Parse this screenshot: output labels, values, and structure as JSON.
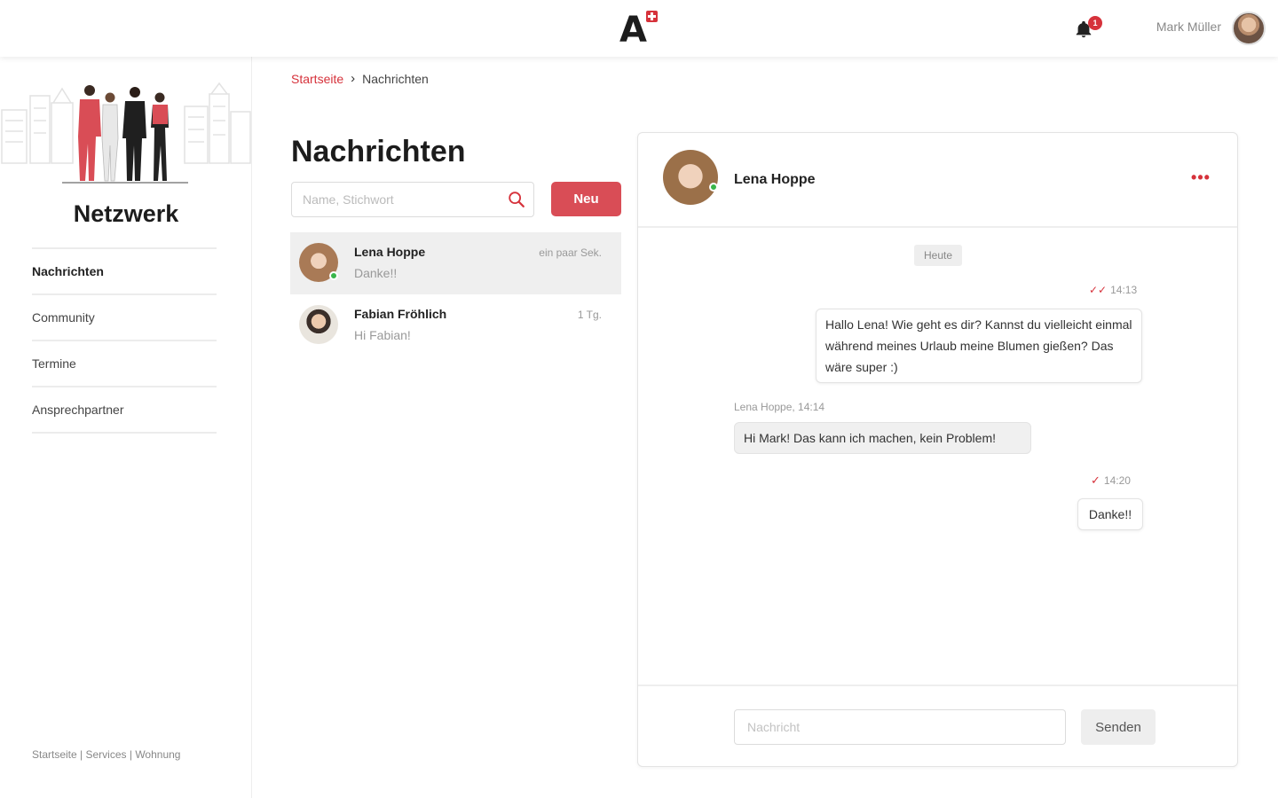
{
  "header": {
    "logo_letter": "A",
    "notification_count": "1",
    "user_name": "Mark Müller"
  },
  "sidebar": {
    "title": "Netzwerk",
    "items": [
      {
        "label": "Nachrichten",
        "active": true
      },
      {
        "label": "Community",
        "active": false
      },
      {
        "label": "Termine",
        "active": false
      },
      {
        "label": "Ansprechpartner",
        "active": false
      }
    ],
    "footer": {
      "link_1": "Startseite",
      "link_2": "Services",
      "link_3": "Wohnung",
      "separator": " | "
    }
  },
  "breadcrumb": {
    "home": "Startseite",
    "separator": "›",
    "current": "Nachrichten"
  },
  "page": {
    "title": "Nachrichten",
    "search_placeholder": "Name, Stichwort",
    "new_button": "Neu"
  },
  "conversations": [
    {
      "name": "Lena Hoppe",
      "preview": "Danke!!",
      "time": "ein paar Sek.",
      "online": true,
      "active": true
    },
    {
      "name": "Fabian Fröhlich",
      "preview": "Hi Fabian!",
      "time": "1 Tg.",
      "online": false,
      "active": false
    }
  ],
  "chat": {
    "contact_name": "Lena Hoppe",
    "more_label": "•••",
    "day_label": "Heute",
    "messages": [
      {
        "direction": "out",
        "time": "14:13",
        "ticks": "✓✓",
        "text": "Hallo Lena! Wie geht es dir? Kannst du vielleicht einmal während meines Urlaub meine Blumen gießen? Das wäre super :)"
      },
      {
        "direction": "in",
        "meta": "Lena Hoppe, 14:14",
        "text": "Hi Mark! Das kann ich machen, kein Problem!"
      },
      {
        "direction": "out",
        "time": "14:20",
        "ticks": "✓",
        "text": "Danke!!"
      }
    ],
    "input_placeholder": "Nachricht",
    "send_button": "Senden"
  },
  "colors": {
    "accent": "#d6323b",
    "button_red": "#d94d56",
    "online": "#39b54a",
    "active_row": "#efefef"
  }
}
